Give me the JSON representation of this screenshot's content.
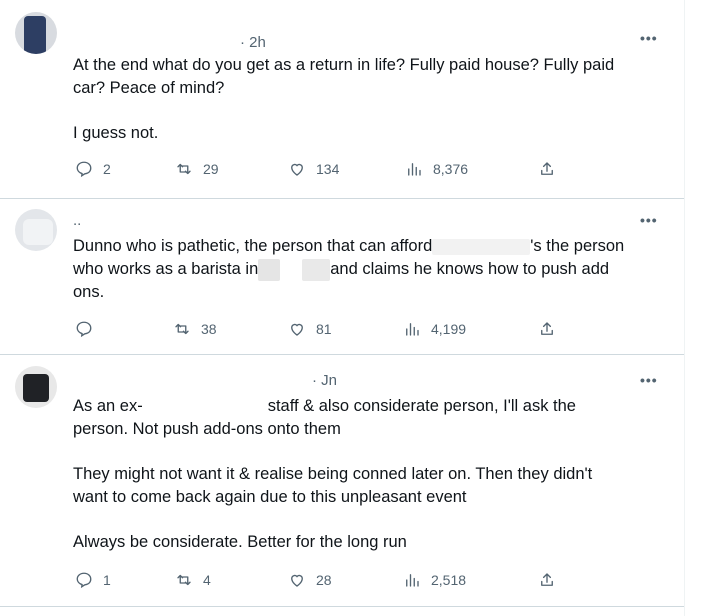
{
  "tweets": [
    {
      "header": "· 2h",
      "lines": [
        "At the end what do you get as a return in life? Fully paid house? Fully paid",
        "car? Peace of mind?"
      ],
      "line2": "I guess not.",
      "stats": {
        "replies": "2",
        "retweets": "29",
        "likes": "134",
        "views": "8,376"
      }
    },
    {
      "header": "..",
      "line1_a": "Dunno who is pathetic, the person that can afford",
      "line1_b": "'s the person",
      "line2_a": "who works as a barista in",
      "line2_b": "and claims he knows how to push add",
      "line3": "ons.",
      "stats": {
        "replies": "",
        "retweets": "38",
        "likes": "81",
        "views": "4,199"
      }
    },
    {
      "header": "· Jn",
      "line1_a": "As an ex-",
      "line1_b": "staff & also considerate person, I'll ask the",
      "line2": "person. Not push add-ons onto them",
      "para2": [
        "They might not want it & realise being conned later on. Then they didn't",
        "want to come back again due to this unpleasant event"
      ],
      "para3": "Always be considerate. Better for the long run",
      "stats": {
        "replies": "1",
        "retweets": "4",
        "likes": "28",
        "views": "2,518"
      }
    }
  ],
  "more_label": "•••",
  "icons": {
    "reply": "reply-icon",
    "retweet": "retweet-icon",
    "like": "like-icon",
    "views": "views-icon",
    "share": "share-icon"
  }
}
